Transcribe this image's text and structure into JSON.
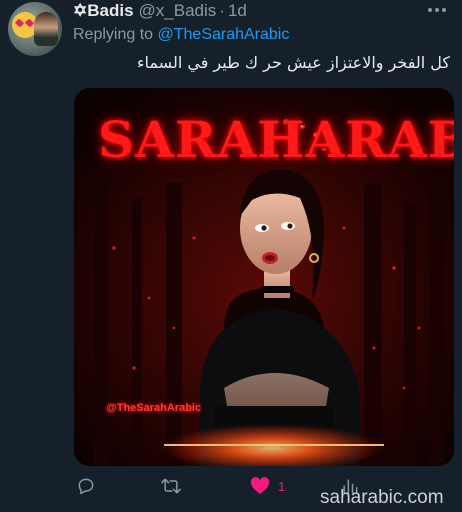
{
  "author": {
    "name": "✡Badis",
    "handle": "@x_Badis",
    "separator": "·",
    "time": "1d"
  },
  "reply_context": {
    "prefix": "Replying to",
    "mention": "@TheSarahArabic"
  },
  "tweet": {
    "text": "كل الفخر والاعتزاز عيش حر ك طير في السماء"
  },
  "media": {
    "logo_text": "SARAHARABIC",
    "watermark_text": "@TheSarahArabic",
    "accent_color": "#ff1a1a"
  },
  "actions": {
    "reply_icon": "reply-icon",
    "retweet_icon": "retweet-icon",
    "like_icon": "heart-icon",
    "like_count": "1",
    "like_color": "#f91880",
    "views_icon": "views-icon"
  },
  "overlay": {
    "site_watermark": "saharabic.com"
  }
}
